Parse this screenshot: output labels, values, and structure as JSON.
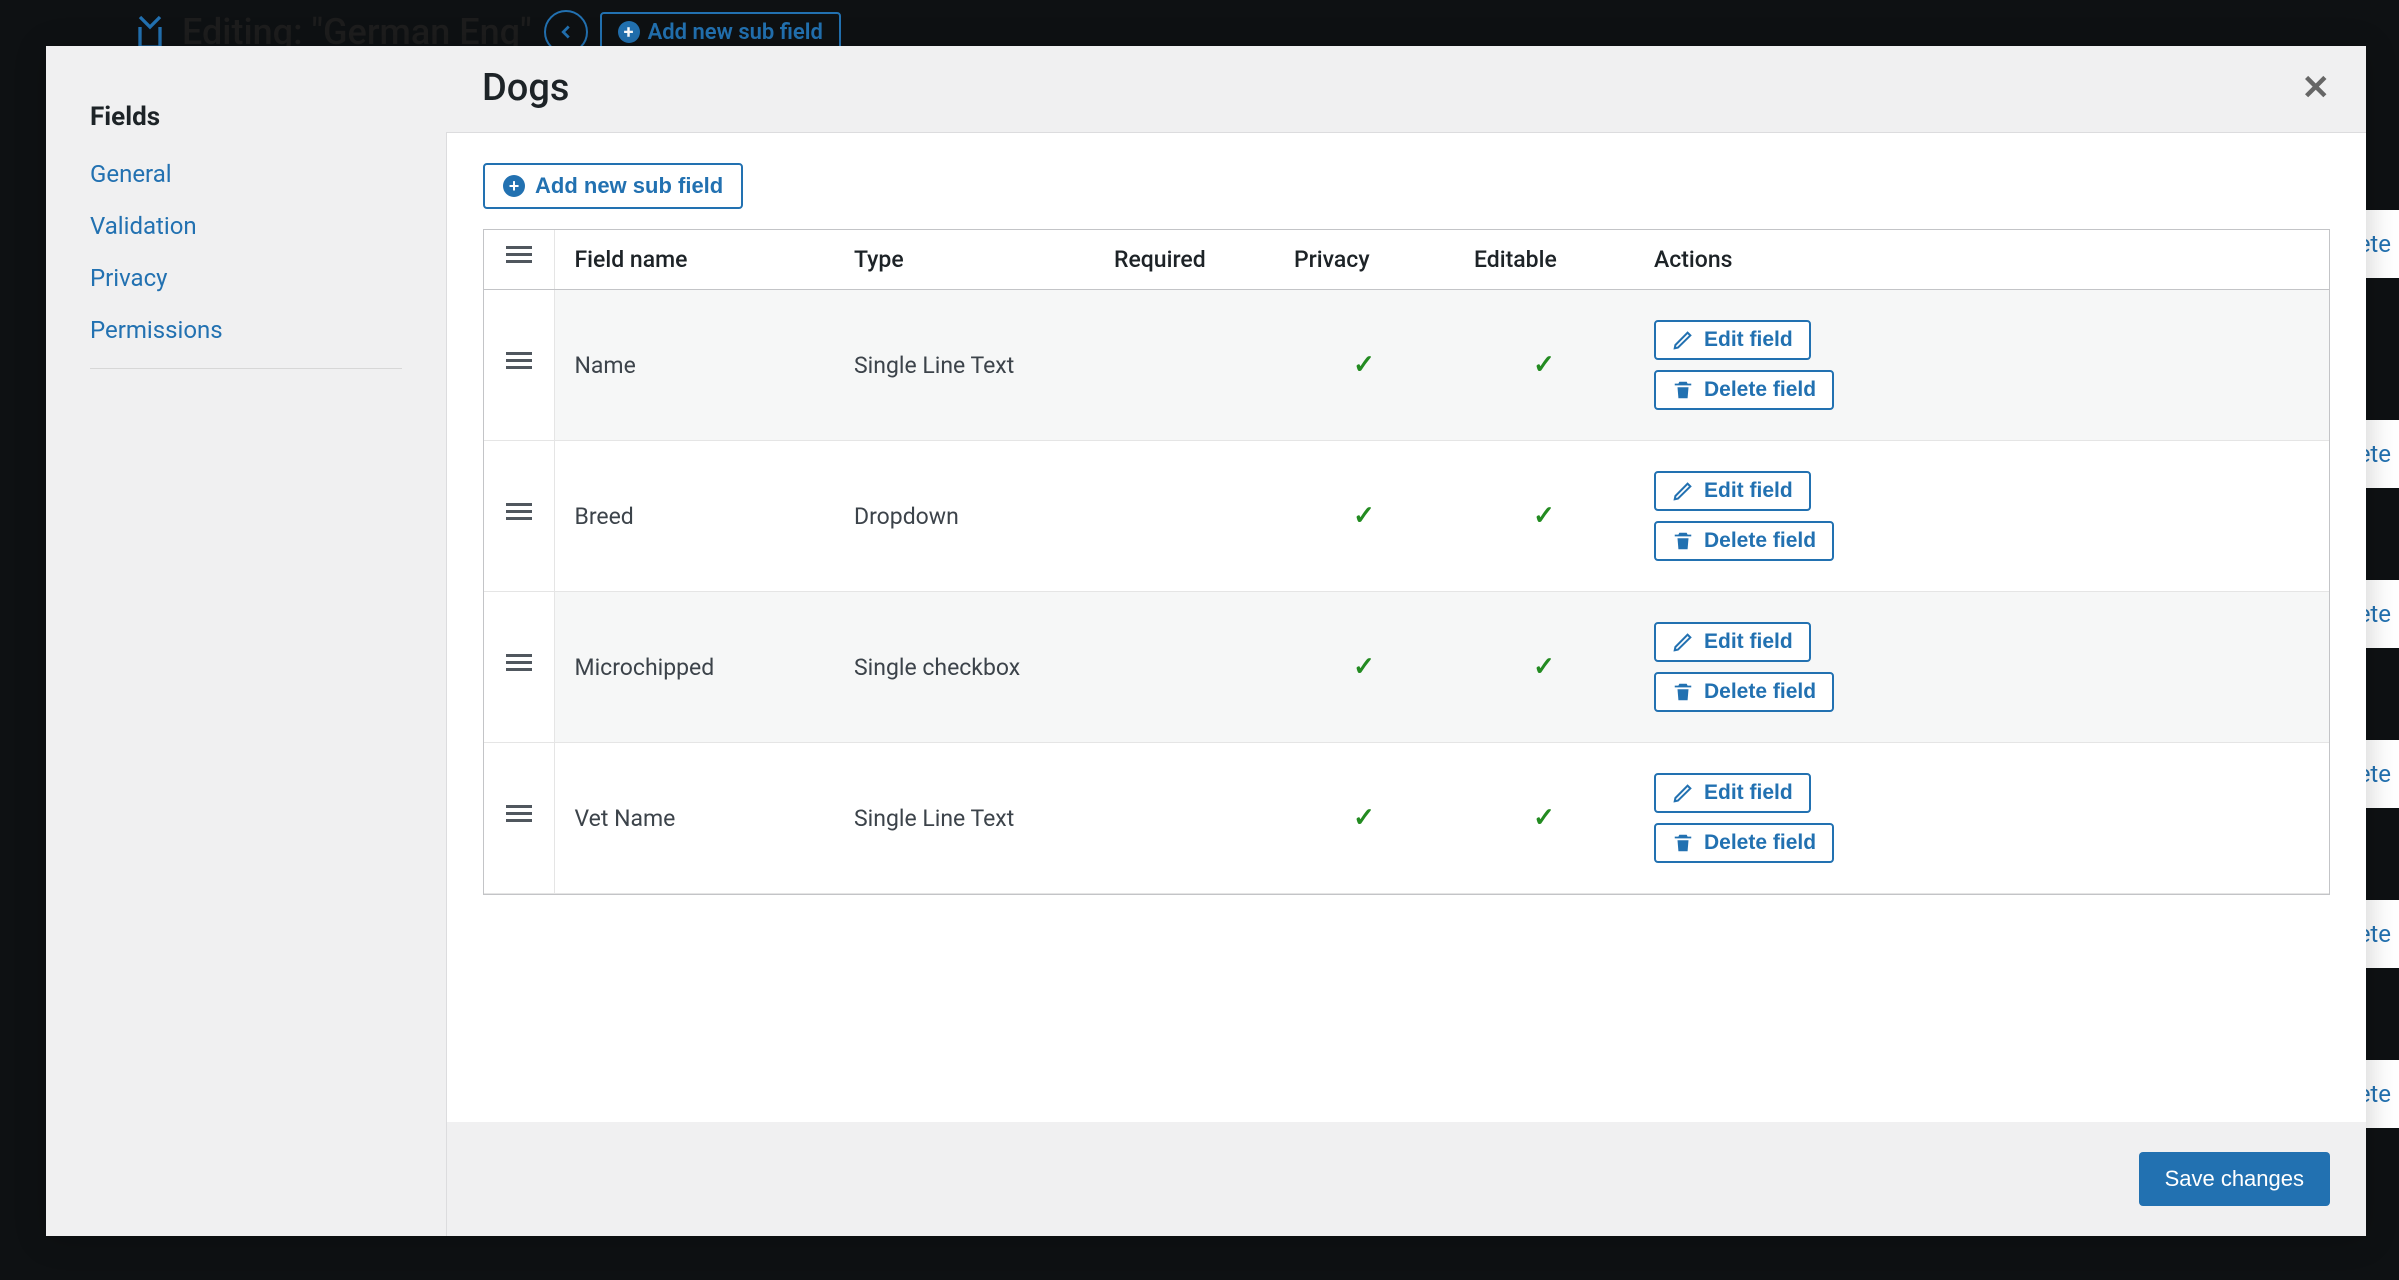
{
  "background": {
    "editing_prefix": "Editing: ",
    "editing_name": "\"German Eng\"",
    "add_sub_field": "Add new sub field",
    "delete_partial": "elete"
  },
  "sidebar": {
    "heading": "Fields",
    "links": [
      "General",
      "Validation",
      "Privacy",
      "Permissions"
    ]
  },
  "modal": {
    "title": "Dogs",
    "add_sub_field": "Add new sub field",
    "save": "Save changes",
    "edit_label": "Edit field",
    "delete_label": "Delete field",
    "columns": {
      "field_name": "Field name",
      "type": "Type",
      "required": "Required",
      "privacy": "Privacy",
      "editable": "Editable",
      "actions": "Actions"
    },
    "rows": [
      {
        "name": "Name",
        "type": "Single Line Text",
        "required": false,
        "privacy": true,
        "editable": true
      },
      {
        "name": "Breed",
        "type": "Dropdown",
        "required": false,
        "privacy": true,
        "editable": true
      },
      {
        "name": "Microchipped",
        "type": "Single checkbox",
        "required": false,
        "privacy": true,
        "editable": true
      },
      {
        "name": "Vet Name",
        "type": "Single Line Text",
        "required": false,
        "privacy": true,
        "editable": true
      }
    ]
  }
}
